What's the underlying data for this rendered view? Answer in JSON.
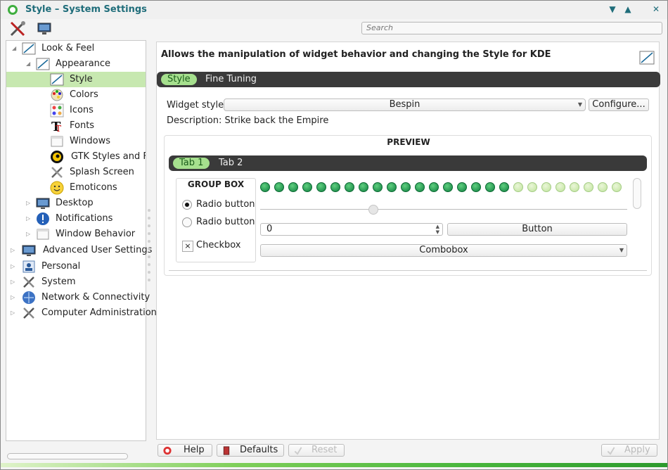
{
  "window": {
    "title": "Style – System Settings"
  },
  "toolbar": {
    "search_placeholder": "Search"
  },
  "sidebar": {
    "items": [
      {
        "label": "Look & Feel",
        "icon": "look-feel-icon"
      },
      {
        "label": "Appearance",
        "icon": "appearance-icon"
      },
      {
        "label": "Style",
        "icon": "style-icon",
        "selected": true
      },
      {
        "label": "Colors",
        "icon": "colors-icon"
      },
      {
        "label": "Icons",
        "icon": "icons-icon"
      },
      {
        "label": "Fonts",
        "icon": "fonts-icon"
      },
      {
        "label": "Windows",
        "icon": "windows-icon"
      },
      {
        "label": "GTK Styles and Fo",
        "icon": "gtk-icon"
      },
      {
        "label": "Splash Screen",
        "icon": "splash-icon"
      },
      {
        "label": "Emoticons",
        "icon": "emoticons-icon"
      },
      {
        "label": "Desktop",
        "icon": "desktop-icon"
      },
      {
        "label": "Notifications",
        "icon": "notifications-icon"
      },
      {
        "label": "Window Behavior",
        "icon": "window-behavior-icon"
      },
      {
        "label": "Advanced User Settings",
        "icon": "advanced-icon"
      },
      {
        "label": "Personal",
        "icon": "personal-icon"
      },
      {
        "label": "System",
        "icon": "system-icon"
      },
      {
        "label": "Network & Connectivity",
        "icon": "network-icon"
      },
      {
        "label": "Computer Administration",
        "icon": "admin-icon"
      }
    ]
  },
  "main": {
    "header": "Allows the manipulation of widget behavior and changing the Style for KDE",
    "tabs": [
      {
        "label": "Style"
      },
      {
        "label": "Fine Tuning"
      }
    ],
    "widget_style_label": "Widget style:",
    "widget_style_value": "Bespin",
    "configure_label": "Configure...",
    "description": "Description: Strike back the Empire",
    "preview": {
      "title": "PREVIEW",
      "tabs": [
        {
          "label": "Tab 1"
        },
        {
          "label": "Tab 2"
        }
      ],
      "groupbox_title": "GROUP BOX",
      "radio1": "Radio button",
      "radio2": "Radio button",
      "checkbox": "Checkbox",
      "checkbox_mark": "×",
      "spin_value": "0",
      "button_label": "Button",
      "combobox_label": "Combobox",
      "leds_total": 26,
      "leds_lit": 18
    }
  },
  "bottom": {
    "help": "Help",
    "defaults": "Defaults",
    "reset": "Reset",
    "apply": "Apply"
  },
  "colors": {
    "accent_green": "#a6e08e",
    "title_teal": "#1f6d7a",
    "tab_bar_dark": "#3a3a3a"
  }
}
